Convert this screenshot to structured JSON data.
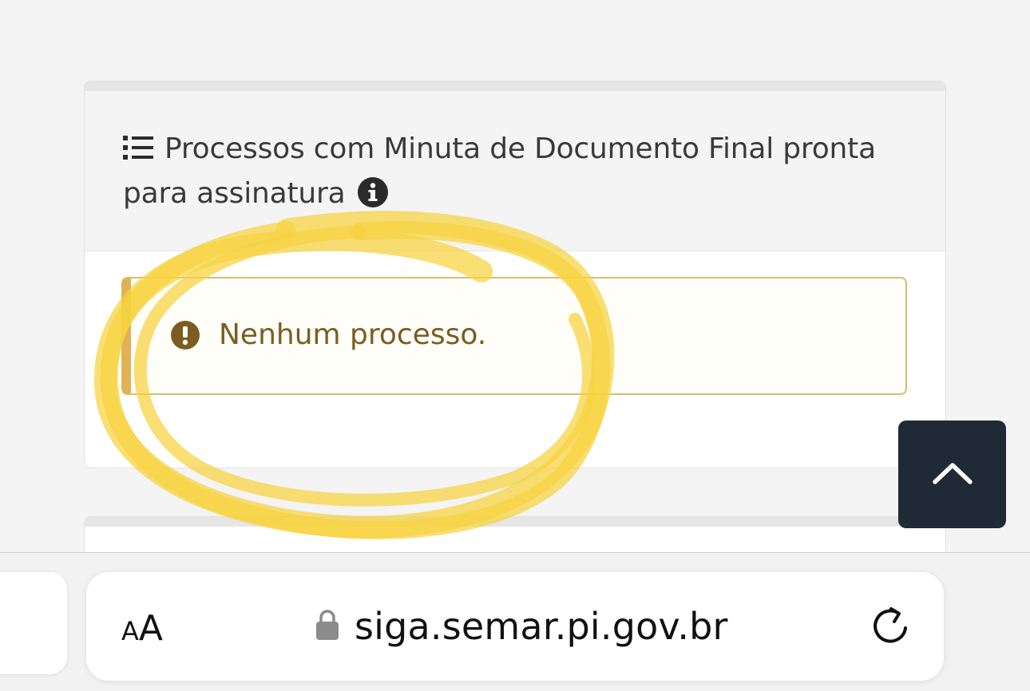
{
  "panel": {
    "title": "Processos com Minuta de Documento Final pronta para assinatura",
    "list_icon": "list-icon",
    "info_icon": "info-circle-icon"
  },
  "alert": {
    "icon": "exclamation-circle-icon",
    "message": "Nenhum processo.",
    "color": "#7b5d22",
    "border_color": "#d9bd6d"
  },
  "scroll_top": {
    "icon": "chevron-up-icon",
    "background": "#1f2a36"
  },
  "annotation": {
    "type": "hand-drawn circle",
    "color": "#f7d23e"
  },
  "browser": {
    "reader_button": {
      "small": "A",
      "large": "A"
    },
    "url": "siga.semar.pi.gov.br",
    "lock_icon": "lock-icon",
    "reload_icon": "reload-icon"
  }
}
